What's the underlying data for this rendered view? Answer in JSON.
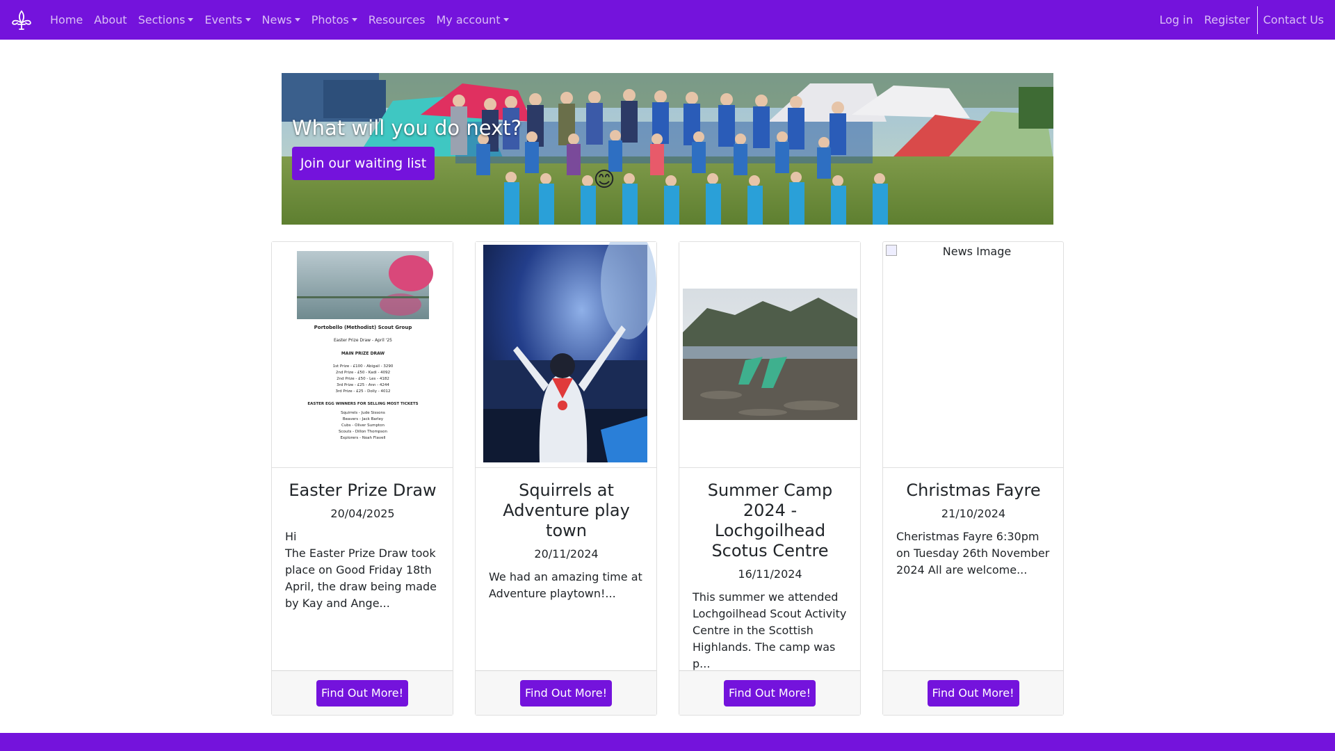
{
  "nav": {
    "brand_icon": "fleur-de-lis-icon",
    "items": [
      {
        "label": "Home",
        "dropdown": false
      },
      {
        "label": "About",
        "dropdown": false
      },
      {
        "label": "Sections",
        "dropdown": true
      },
      {
        "label": "Events",
        "dropdown": true
      },
      {
        "label": "News",
        "dropdown": true
      },
      {
        "label": "Photos",
        "dropdown": true
      },
      {
        "label": "Resources",
        "dropdown": false
      },
      {
        "label": "My account",
        "dropdown": true
      }
    ],
    "right": {
      "login": "Log in",
      "register": "Register",
      "contact": "Contact Us"
    }
  },
  "hero": {
    "title": "What will you do next?",
    "button": "Join our waiting list",
    "emoji": "😊"
  },
  "cards": [
    {
      "title": "Easter Prize Draw",
      "date": "20/04/2025",
      "text": "Hi\nThe Easter Prize Draw took place on Good Friday 18th April, the draw being made by Kay and Ange...",
      "button": "Find Out More!",
      "poster": {
        "org": "Portobello (Methodist) Scout Group",
        "subtitle": "Easter Prize Draw - April '25",
        "heading": "MAIN PRIZE DRAW",
        "rows": [
          "1st Prize  -  £100  -  Abigail  -  3290",
          "2nd Prize  -  £50  -  Kadi  -  4092",
          "2nd Prize  -  £50  -  Les  -  4182",
          "3rd Prize  -  £25  -  Ann  -  4244",
          "3rd Prize  -  £25  -  Dolly  -  4012"
        ],
        "heading2": "EASTER EGG WINNERS FOR SELLING MOST TICKETS",
        "winners": [
          "Squirrels  -  Jude Sissons",
          "Beavers  -  Jack Barley",
          "Cubs  -  Oliver Sumpton",
          "Scouts  -  Dillon Thompson",
          "Explorers  -  Noah Flavell"
        ]
      }
    },
    {
      "title": "Squirrels at Adventure play town",
      "date": "20/11/2024",
      "text": "We had an amazing time at Adventure playtown!...",
      "button": "Find Out More!"
    },
    {
      "title": "Summer Camp 2024 - Lochgoilhead Scotus Centre",
      "date": "16/11/2024",
      "text": "This summer we attended Lochgoilhead Scout Activity Centre in the Scottish Highlands. The camp was p...",
      "button": "Find Out More!"
    },
    {
      "title": "Christmas Fayre",
      "date": "21/10/2024",
      "text": "Cheristmas Fayre 6:30pm on Tuesday 26th November 2024 All are welcome...",
      "button": "Find Out More!",
      "image_alt": "News Image"
    }
  ],
  "colors": {
    "brand": "#7413dc",
    "footer_bg": "#f7f7f7"
  }
}
